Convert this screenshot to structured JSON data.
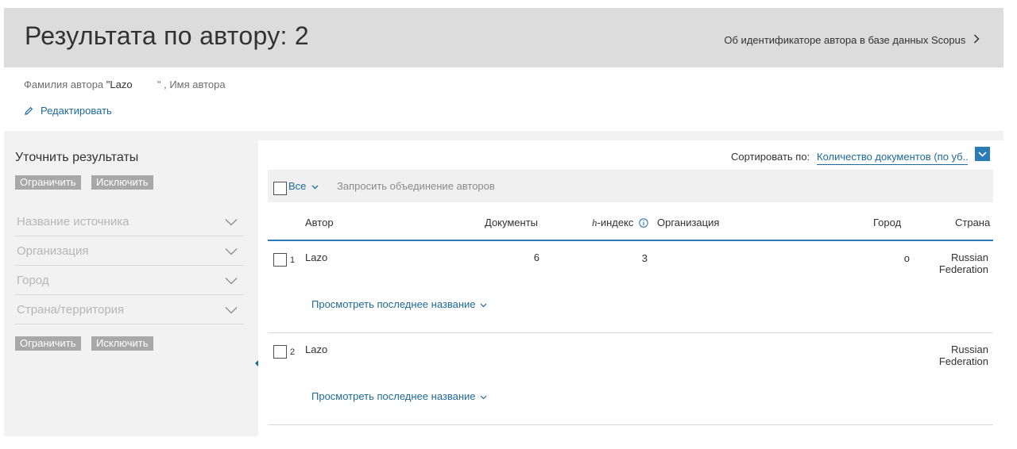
{
  "header": {
    "title": "Результата по автору: 2",
    "about_link": "Об идентификаторе автора в базе данных Scopus"
  },
  "query": {
    "last_name_label": "Фамилия автора",
    "last_name_value": "\"Lazo",
    "separator": "\" ,",
    "first_name_label": "Имя автора",
    "edit_label": "Редактировать"
  },
  "sidebar": {
    "title": "Уточнить результаты",
    "limit_label": "Ограничить",
    "exclude_label": "Исключить",
    "filters": [
      {
        "label": "Название источника"
      },
      {
        "label": "Организация"
      },
      {
        "label": "Город"
      },
      {
        "label": "Страна/территория"
      }
    ]
  },
  "results": {
    "sort_label": "Сортировать по:",
    "sort_value": "Количество документов (по уб...",
    "all_label": "Все",
    "merge_label": "Запросить объединение авторов",
    "columns": {
      "author": "Автор",
      "documents": "Документы",
      "h_prefix": "h",
      "h_suffix": "-индекс",
      "organization": "Организация",
      "city": "Город",
      "country": "Страна"
    },
    "rows": [
      {
        "num": "1",
        "author": "Lazo",
        "documents": "6",
        "h_index": "3",
        "organization": "",
        "city": "o",
        "country_line1": "Russian",
        "country_line2": "Federation",
        "view_link": "Просмотреть последнее название"
      },
      {
        "num": "2",
        "author": "Lazo",
        "documents": "",
        "h_index": "",
        "organization": "",
        "city": "",
        "country_line1": "Russian",
        "country_line2": "Federation",
        "view_link": "Просмотреть последнее название"
      }
    ]
  },
  "colors": {
    "link": "#1d6a9c",
    "accent": "#2b7bb6",
    "header_bg": "#dcdcdc",
    "panel_bg": "#f2f2f2",
    "button_gray": "#a8a8a8"
  }
}
